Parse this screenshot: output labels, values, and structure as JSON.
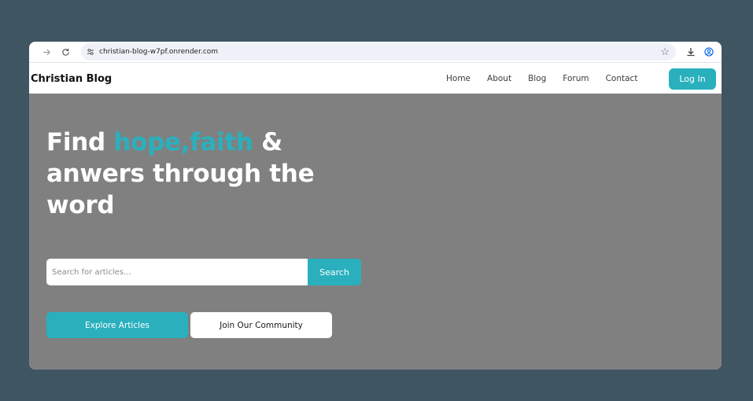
{
  "browser": {
    "url": "christian-blog-w7pf.onrender.com",
    "icons": {
      "forward": "arrow-right-icon",
      "reload": "reload-icon",
      "site_info": "tune-icon",
      "bookmark": "star-icon",
      "downloads": "download-icon",
      "profile": "profile-icon"
    }
  },
  "site": {
    "brand": "Christian Blog",
    "nav": [
      "Home",
      "About",
      "Blog",
      "Forum",
      "Contact"
    ],
    "login_label": "Log In"
  },
  "hero": {
    "title_prefix": "Find ",
    "title_accent": "hope,faith",
    "title_suffix": " & anwers through the word",
    "search_placeholder": "Search for articles...",
    "search_label": "Search",
    "explore_label": "Explore Articles",
    "join_label": "Join Our Community"
  },
  "colors": {
    "accent": "#2ab0bd",
    "hero_bg": "#808080",
    "page_bg": "#3f5562"
  }
}
